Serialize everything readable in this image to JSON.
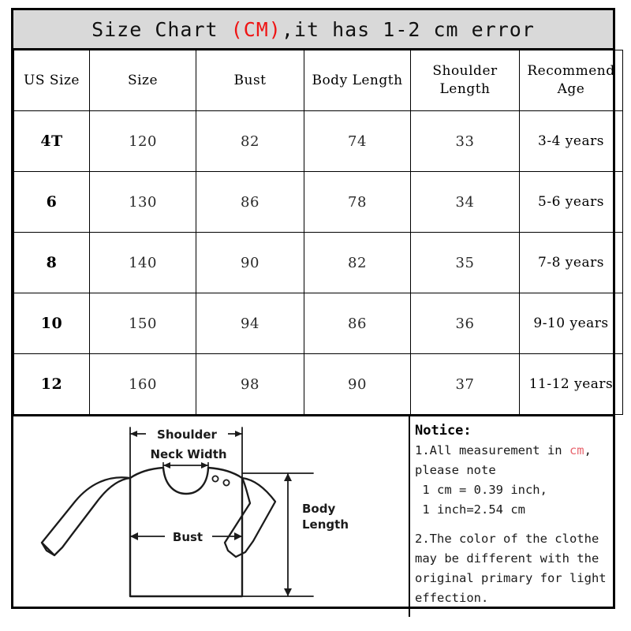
{
  "title": {
    "prefix": "Size Chart ",
    "unit": "(CM)",
    "suffix": ",it has 1-2 cm error"
  },
  "table": {
    "headers": [
      "US Size",
      "Size",
      "Bust",
      "Body Length",
      "Shoulder\nLength",
      "Recommend\nAge"
    ],
    "headers_flat": [
      "US Size",
      "Size",
      "Bust",
      "Body Length",
      "Shoulder Length",
      "Recommend Age"
    ],
    "rows": [
      {
        "us_size": "4T",
        "size": "120",
        "bust": "82",
        "body_length": "74",
        "shoulder_length": "33",
        "recommend_age": "3-4 years"
      },
      {
        "us_size": "6",
        "size": "130",
        "bust": "86",
        "body_length": "78",
        "shoulder_length": "34",
        "recommend_age": "5-6 years"
      },
      {
        "us_size": "8",
        "size": "140",
        "bust": "90",
        "body_length": "82",
        "shoulder_length": "35",
        "recommend_age": "7-8 years"
      },
      {
        "us_size": "10",
        "size": "150",
        "bust": "94",
        "body_length": "86",
        "shoulder_length": "36",
        "recommend_age": "9-10 years"
      },
      {
        "us_size": "12",
        "size": "160",
        "bust": "98",
        "body_length": "90",
        "shoulder_length": "37",
        "recommend_age": "11-12 years"
      }
    ]
  },
  "diagram": {
    "labels": {
      "shoulder": "Shoulder",
      "neck_width": "Neck Width",
      "bust": "Bust",
      "body_length_1": "Body",
      "body_length_2": "Length"
    }
  },
  "notice": {
    "heading": "Notice:",
    "line1_a": "1.All measurement in ",
    "line1_red": "cm",
    "line1_b": ",",
    "line2": "please note",
    "line3": " 1 cm = 0.39 inch,",
    "line4": " 1 inch=2.54 cm",
    "line5": "2.The color of the clothe",
    "line6": "may be different with the",
    "line7": "original primary for light",
    "line8": "effection."
  },
  "colors": {
    "title_band": "#d9d9d9",
    "accent_red": "#ef1414",
    "notice_red": "#e8666f",
    "border": "#000000"
  }
}
